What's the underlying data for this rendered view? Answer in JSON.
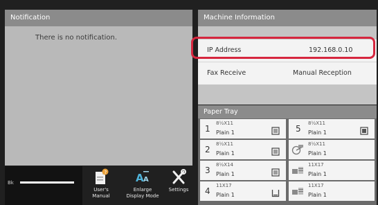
{
  "notification": {
    "title": "Notification",
    "message": "There is no notification."
  },
  "toner": {
    "label": "Bk"
  },
  "functions": [
    {
      "label_1": "User's",
      "label_2": "Manual",
      "icon": "users-manual-icon"
    },
    {
      "label_1": "Enlarge",
      "label_2": "Display Mode",
      "icon": "enlarge-text-icon"
    },
    {
      "label_1": "Settings",
      "label_2": "",
      "icon": "settings-tools-icon"
    }
  ],
  "machine_info": {
    "title": "Machine Information",
    "rows": [
      {
        "key": "IP Address",
        "value": "192.168.0.10"
      },
      {
        "key": "Fax Receive",
        "value": "Manual Reception"
      }
    ]
  },
  "paper_tray": {
    "title": "Paper Tray",
    "trays": [
      {
        "number": "1",
        "size": "8½X11",
        "type": "Plain 1",
        "icon": "tray-icon"
      },
      {
        "number": "2",
        "size": "8½X11",
        "type": "Plain 1",
        "icon": "tray-icon"
      },
      {
        "number": "3",
        "size": "8½X14",
        "type": "Plain 1",
        "icon": "tray-icon"
      },
      {
        "number": "4",
        "size": "11X17",
        "type": "Plain 1",
        "icon": "tray-icon"
      },
      {
        "number": "5",
        "size": "8½X11",
        "type": "Plain 1",
        "icon": "tray-icon"
      },
      {
        "number": "",
        "size": "8½X11",
        "type": "Plain 1",
        "icon": "bypass-tray-icon"
      },
      {
        "number": "",
        "size": "11X17",
        "type": "Plain 1",
        "icon": "large-capacity-tray-icon"
      },
      {
        "number": "",
        "size": "11X17",
        "type": "Plain 1",
        "icon": "large-capacity-tray-icon"
      }
    ]
  },
  "colors": {
    "highlight": "#d6263e",
    "panel_header": "#8b8b8b",
    "background": "#202020"
  }
}
